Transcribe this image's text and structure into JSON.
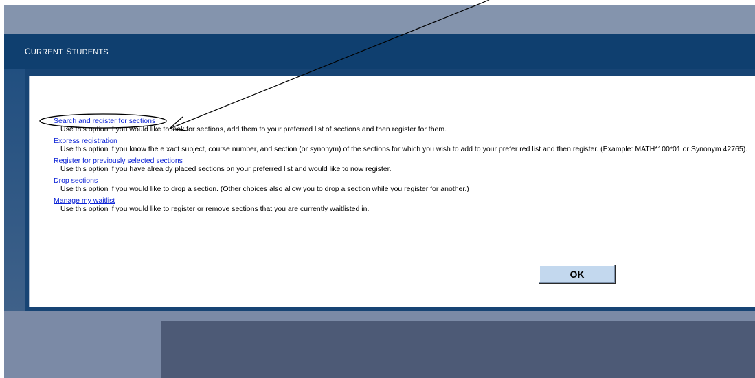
{
  "header": {
    "title_first_cap": "C",
    "title_first_rest": "urrent ",
    "title_second_cap": "S",
    "title_second_rest": "tudents"
  },
  "options": [
    {
      "link": "Search and register for sections",
      "description": "Use this option if you would like to look for sections, add them to your preferred list of sections and then register for them."
    },
    {
      "link": "Express registration",
      "description": "Use this option if you know the e xact subject, course number, and section (or synonym) of the sections for which you wish to add to your prefer red list and then register. (Example: MATH*100*01 or Synonym 42765)."
    },
    {
      "link": "Register for previously selected sections",
      "description": "Use this option if you have alrea dy placed sections on your preferred list and would like to now register."
    },
    {
      "link": "Drop sections",
      "description": "Use this option if you would like to drop a section. (Other choices also allow you to drop a section while you register for another.)"
    },
    {
      "link": "Manage my waitlist",
      "description": "Use this option if you would like to register or remove sections that you are currently waitlisted in."
    }
  ],
  "buttons": {
    "ok_label": "OK"
  },
  "colors": {
    "header_band": "#0f3f6f",
    "top_band": "#8494ad",
    "link": "#0b22d6",
    "ok_button": "#c3d8ee"
  }
}
